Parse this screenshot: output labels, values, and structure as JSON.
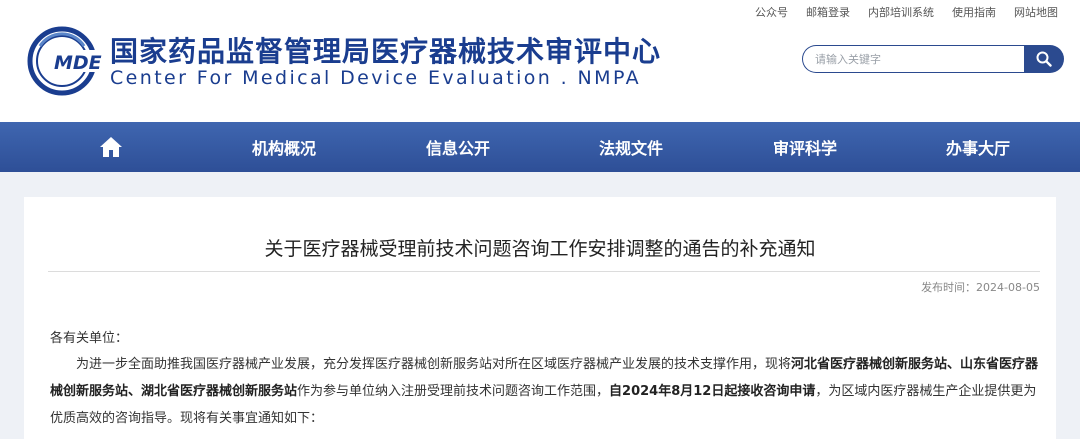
{
  "toplinks": [
    "公众号",
    "邮箱登录",
    "内部培训系统",
    "使用指南",
    "网站地图"
  ],
  "logo": {
    "text": "MDE"
  },
  "site": {
    "cn_title": "国家药品监督管理局医疗器械技术审评中心",
    "en_title": "Center For Medical Device Evaluation . NMPA"
  },
  "search": {
    "placeholder": "请输入关键字"
  },
  "nav": {
    "home_icon": "home-icon",
    "items": [
      "机构概况",
      "信息公开",
      "法规文件",
      "审评科学",
      "办事大厅"
    ]
  },
  "article": {
    "title": "关于医疗器械受理前技术问题咨询工作安排调整的通告的补充通知",
    "pubtime": "发布时间：2024-08-05",
    "salutation": "各有关单位：",
    "p1_a": "为进一步全面助推我国医疗器械产业发展，充分发挥医疗器械创新服务站对所在区域医疗器械产业发展的技术支撑作用，现将",
    "p1_b": "河北省医疗器械创新服务站、山东省医疗器械创新服务站、湖北省医疗器械创新服务站",
    "p1_c": "作为参与单位纳入注册受理前技术问题咨询工作范围，",
    "p1_d": "自2024年8月12日起接收咨询申请",
    "p1_e": "，为区域内医疗器械生产企业提供更为优质高效的咨询指导。现将有关事宜通知如下："
  },
  "colors": {
    "brand": "#1a3d8f",
    "nav_bg": "#3a5fa8",
    "search": "#2b4a8f"
  }
}
